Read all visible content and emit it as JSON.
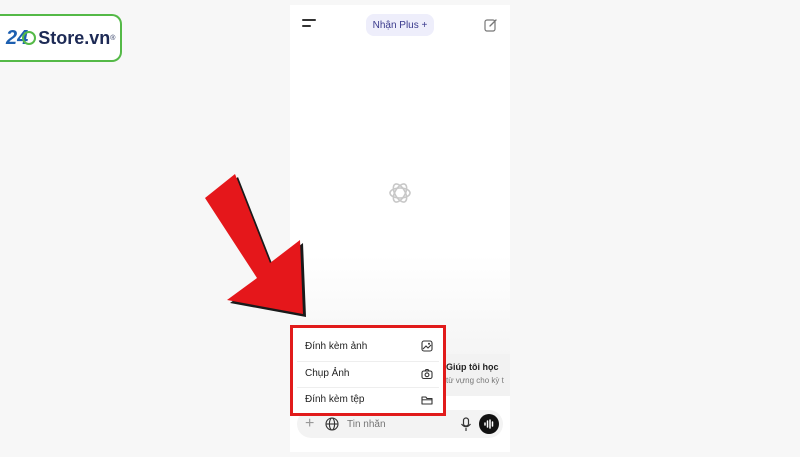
{
  "watermark": {
    "number": "24",
    "text": "Store.vn",
    "reg": "®"
  },
  "header": {
    "plus_label": "Nhận Plus +"
  },
  "suggestion": {
    "title": "Giúp tôi học",
    "subtitle": "từ vựng cho kỳ t"
  },
  "attach_menu": {
    "items": [
      {
        "label": "Đính kèm ảnh",
        "icon": "image-icon"
      },
      {
        "label": "Chụp Ảnh",
        "icon": "camera-icon"
      },
      {
        "label": "Đính kèm tệp",
        "icon": "folder-icon"
      }
    ]
  },
  "composer": {
    "plus": "+",
    "placeholder": "Tin nhắn"
  },
  "colors": {
    "highlight": "#e11b1b",
    "brand_green": "#54b947",
    "brand_blue": "#1d5fb0"
  }
}
